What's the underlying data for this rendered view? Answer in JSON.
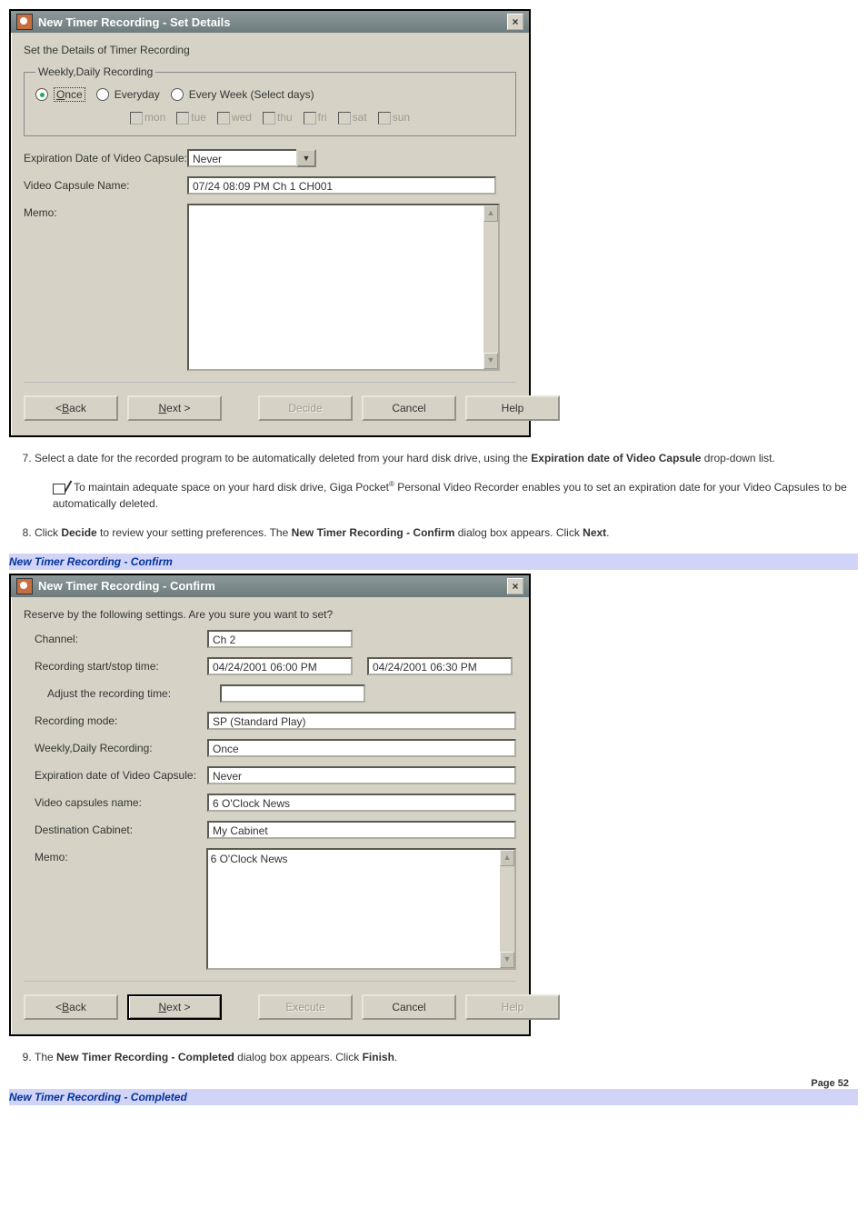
{
  "dialog1": {
    "title": "New Timer Recording - Set Details",
    "section_label": "Set the Details of Timer Recording",
    "weekly_legend": "Weekly,Daily Recording",
    "radio_once": "Once",
    "radio_everyday": "Everyday",
    "radio_selectdays": "Every Week (Select days)",
    "days": [
      "mon",
      "tue",
      "wed",
      "thu",
      "fri",
      "sat",
      "sun"
    ],
    "expiry_label": "Expiration Date of Video Capsule:",
    "expiry_value": "Never",
    "capsule_name_label": "Video Capsule Name:",
    "capsule_name_value": "07/24 08:09 PM Ch 1 CH001",
    "memo_label": "Memo:",
    "buttons": {
      "back": "Back",
      "next": "Next >",
      "decide": "Decide",
      "cancel": "Cancel",
      "help": "Help"
    }
  },
  "step7": {
    "text_pre": "Select a date for the recorded program to be automatically deleted from your hard disk drive, using the ",
    "bold": "Expiration date of Video Capsule",
    "text_post": " drop-down list."
  },
  "note": {
    "pre": " To maintain adequate space on your hard disk drive, Giga Pocket",
    "post": " Personal Video Recorder enables you to set an expiration date for your Video Capsules to be automatically deleted."
  },
  "step8": {
    "p1": "Click ",
    "b1": "Decide",
    "p2": " to review your setting preferences. The ",
    "b2": "New Timer Recording - Confirm",
    "p3": " dialog box appears. Click ",
    "b3": "Next",
    "p4": "."
  },
  "caption1": "New Timer Recording - Confirm",
  "dialog2": {
    "title": "New Timer Recording - Confirm",
    "subtitle": "Reserve by the following settings. Are you sure you want to set?",
    "channel_label": "Channel:",
    "channel_value": "Ch 2",
    "startstop_label": "Recording start/stop time:",
    "start_value": "04/24/2001 06:00 PM",
    "stop_value": "04/24/2001 06:30 PM",
    "adjust_label": "Adjust the recording time:",
    "adjust_value": "",
    "mode_label": "Recording mode:",
    "mode_value": "SP (Standard Play)",
    "weekly_label": "Weekly,Daily Recording:",
    "weekly_value": "Once",
    "expiry_label": "Expiration date of Video Capsule:",
    "expiry_value": "Never",
    "capsules_label": "Video capsules name:",
    "capsules_value": "6 O'Clock News",
    "cabinet_label": "Destination Cabinet:",
    "cabinet_value": "My Cabinet",
    "memo_label": "Memo:",
    "memo_value": "6 O'Clock News",
    "buttons": {
      "back": "Back",
      "next": "Next >",
      "execute": "Execute",
      "cancel": "Cancel",
      "help": "Help"
    }
  },
  "step9": {
    "p1": "The ",
    "b1": "New Timer Recording - Completed",
    "p2": " dialog box appears. Click ",
    "b2": "Finish",
    "p3": "."
  },
  "page_num": "Page 52",
  "caption2": "New Timer Recording - Completed"
}
